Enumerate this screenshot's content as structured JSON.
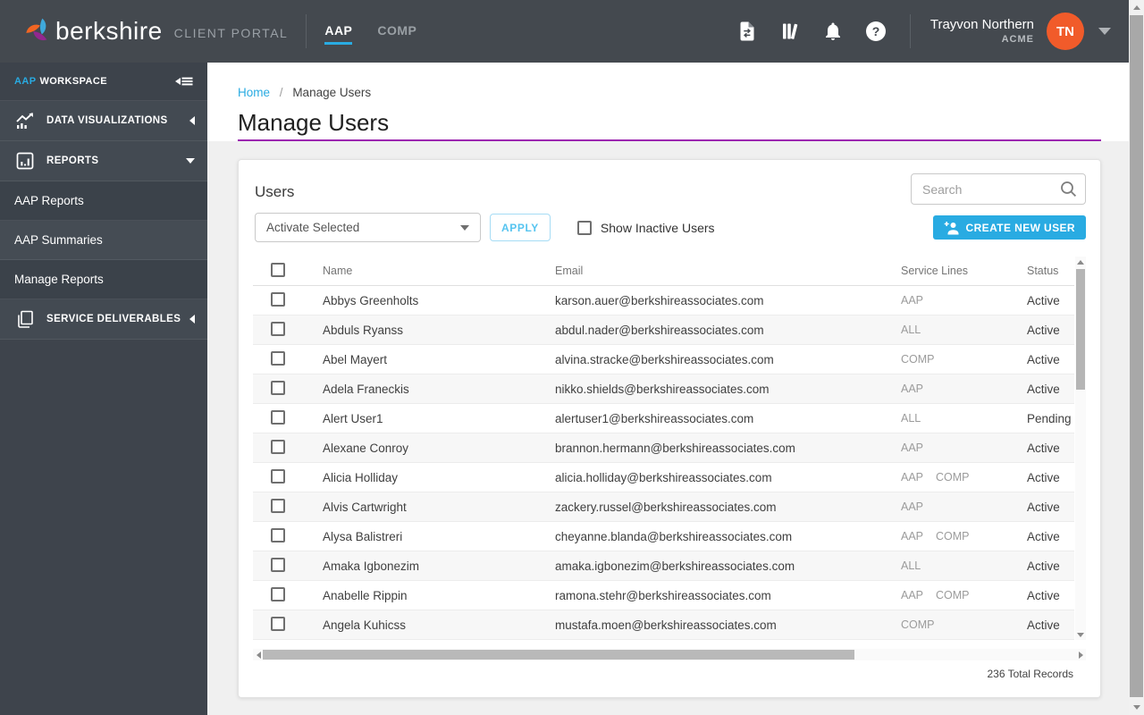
{
  "header": {
    "brand": "berkshire",
    "portal_label": "CLIENT PORTAL",
    "tabs": [
      {
        "label": "AAP",
        "active": true
      },
      {
        "label": "COMP",
        "active": false
      }
    ],
    "icon_names": [
      "file-transfer-icon",
      "library-books-icon",
      "notifications-bell-icon",
      "help-icon"
    ],
    "user": {
      "name": "Trayvon Northern",
      "company": "ACME",
      "initials": "TN"
    }
  },
  "sidebar": {
    "workspace_prefix": "AAP",
    "workspace_label": "WORKSPACE",
    "sections": [
      {
        "label": "DATA VISUALIZATIONS",
        "icon": "chart-insights-icon",
        "state": "collapsed"
      },
      {
        "label": "REPORTS",
        "icon": "chart-box-icon",
        "state": "expanded",
        "children": [
          {
            "label": "AAP Reports"
          },
          {
            "label": "AAP Summaries"
          },
          {
            "label": "Manage Reports"
          }
        ]
      },
      {
        "label": "SERVICE DELIVERABLES",
        "icon": "stacked-docs-icon",
        "state": "collapsed"
      }
    ]
  },
  "breadcrumb": {
    "home": "Home",
    "separator": "/",
    "current": "Manage Users"
  },
  "page": {
    "title": "Manage Users"
  },
  "panel": {
    "title": "Users",
    "search_placeholder": "Search",
    "bulk_action_value": "Activate Selected",
    "apply_label": "APPLY",
    "show_inactive_label": "Show Inactive Users",
    "create_user_label": "CREATE NEW USER",
    "total_records": "236 Total Records"
  },
  "table": {
    "columns": [
      "Name",
      "Email",
      "Service Lines",
      "Status"
    ],
    "rows": [
      {
        "name": "Abbys Greenholts",
        "email": "karson.auer@berkshireassociates.com",
        "service_lines": [
          "AAP"
        ],
        "status": "Active"
      },
      {
        "name": "Abduls Ryanss",
        "email": "abdul.nader@berkshireassociates.com",
        "service_lines": [
          "ALL"
        ],
        "status": "Active"
      },
      {
        "name": "Abel Mayert",
        "email": "alvina.stracke@berkshireassociates.com",
        "service_lines": [
          "COMP"
        ],
        "status": "Active"
      },
      {
        "name": "Adela Franeckis",
        "email": "nikko.shields@berkshireassociates.com",
        "service_lines": [
          "AAP"
        ],
        "status": "Active"
      },
      {
        "name": "Alert User1",
        "email": "alertuser1@berkshireassociates.com",
        "service_lines": [
          "ALL"
        ],
        "status": "Pending"
      },
      {
        "name": "Alexane Conroy",
        "email": "brannon.hermann@berkshireassociates.com",
        "service_lines": [
          "AAP"
        ],
        "status": "Active"
      },
      {
        "name": "Alicia Holliday",
        "email": "alicia.holliday@berkshireassociates.com",
        "service_lines": [
          "AAP",
          "COMP"
        ],
        "status": "Active"
      },
      {
        "name": "Alvis Cartwright",
        "email": "zackery.russel@berkshireassociates.com",
        "service_lines": [
          "AAP"
        ],
        "status": "Active"
      },
      {
        "name": "Alysa Balistreri",
        "email": "cheyanne.blanda@berkshireassociates.com",
        "service_lines": [
          "AAP",
          "COMP"
        ],
        "status": "Active"
      },
      {
        "name": "Amaka Igbonezim",
        "email": "amaka.igbonezim@berkshireassociates.com",
        "service_lines": [
          "ALL"
        ],
        "status": "Active"
      },
      {
        "name": "Anabelle Rippin",
        "email": "ramona.stehr@berkshireassociates.com",
        "service_lines": [
          "AAP",
          "COMP"
        ],
        "status": "Active"
      },
      {
        "name": "Angela Kuhicss",
        "email": "mustafa.moen@berkshireassociates.com",
        "service_lines": [
          "COMP"
        ],
        "status": "Active"
      }
    ]
  },
  "colors": {
    "accent_blue": "#29abe2",
    "title_underline_purple": "#9c27b0",
    "avatar_orange": "#f15b2a",
    "header_bg": "#44494f",
    "sidebar_bg": "#3e444c"
  }
}
